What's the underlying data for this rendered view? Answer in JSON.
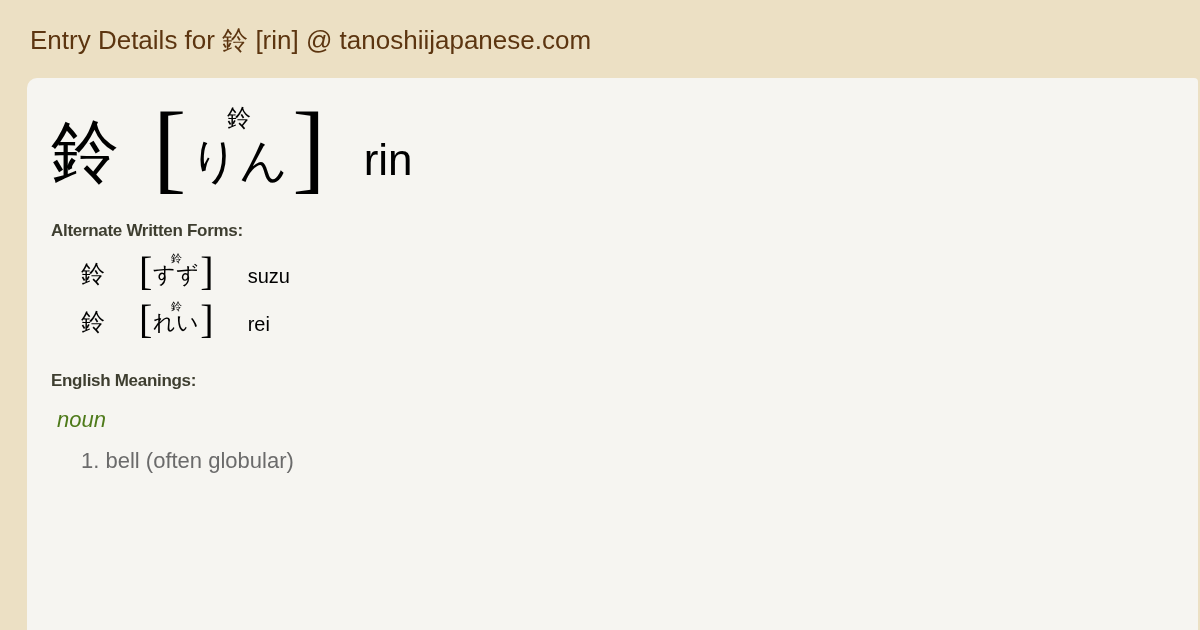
{
  "page_title": "Entry Details for 鈴 [rin] @ tanoshiijapanese.com",
  "entry": {
    "kanji": "鈴",
    "bracket_open": "[",
    "furigana": "鈴",
    "kana": "りん",
    "bracket_close": "]",
    "romaji": "rin"
  },
  "alternate_forms": {
    "heading": "Alternate Written Forms:",
    "items": [
      {
        "kanji": "鈴",
        "bracket_open": "[",
        "furigana": "鈴",
        "kana": "すず",
        "bracket_close": "]",
        "romaji": "suzu"
      },
      {
        "kanji": "鈴",
        "bracket_open": "[",
        "furigana": "鈴",
        "kana": "れい",
        "bracket_close": "]",
        "romaji": "rei"
      }
    ]
  },
  "meanings": {
    "heading": "English Meanings:",
    "part_of_speech": "noun",
    "items": [
      "1. bell (often globular)"
    ]
  }
}
